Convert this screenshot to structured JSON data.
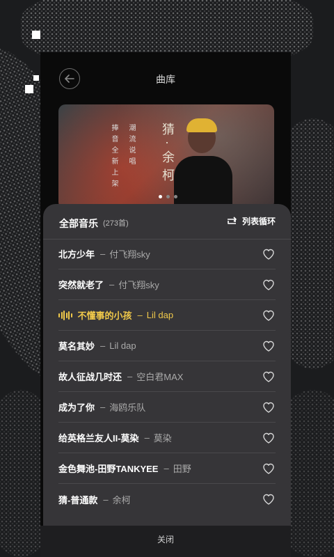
{
  "header": {
    "title": "曲库"
  },
  "banner": {
    "left_text": [
      "捧音全新上架",
      "潮流说唱"
    ],
    "song_title": "猜·余柯",
    "dots": 3,
    "active_dot": 0
  },
  "playlist": {
    "title": "全部音乐",
    "count": "(273首)",
    "mode": "列表循环",
    "songs": [
      {
        "title": "北方少年",
        "artist": "付飞翔sky",
        "playing": false
      },
      {
        "title": "突然就老了",
        "artist": "付飞翔sky",
        "playing": false
      },
      {
        "title": "不懂事的小孩",
        "artist": "Lil dap",
        "playing": true
      },
      {
        "title": "莫名其妙",
        "artist": "Lil dap",
        "playing": false
      },
      {
        "title": "故人征战几时还",
        "artist": "空白君MAX",
        "playing": false
      },
      {
        "title": "成为了你",
        "artist": "海鸥乐队",
        "playing": false
      },
      {
        "title": "给英格兰友人II-莫染",
        "artist": "莫染",
        "playing": false
      },
      {
        "title": "金色舞池-田野TANKYEE",
        "artist": "田野",
        "playing": false
      },
      {
        "title": "猜-普通款",
        "artist": "余柯",
        "playing": false
      }
    ]
  },
  "footer": {
    "close_label": "关闭"
  },
  "colors": {
    "playing": "#f1c94a",
    "sheet": "#363538"
  }
}
